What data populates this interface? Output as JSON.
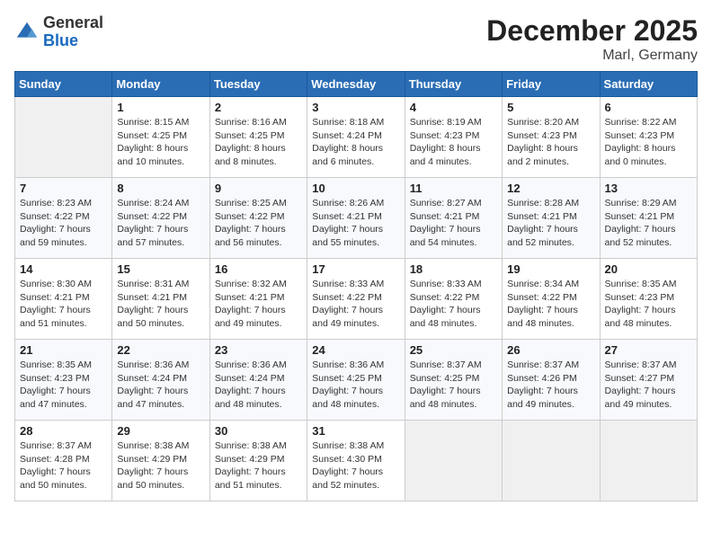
{
  "header": {
    "logo_general": "General",
    "logo_blue": "Blue",
    "title": "December 2025",
    "subtitle": "Marl, Germany"
  },
  "days_of_week": [
    "Sunday",
    "Monday",
    "Tuesday",
    "Wednesday",
    "Thursday",
    "Friday",
    "Saturday"
  ],
  "weeks": [
    [
      {
        "day": "",
        "info": ""
      },
      {
        "day": "1",
        "info": "Sunrise: 8:15 AM\nSunset: 4:25 PM\nDaylight: 8 hours\nand 10 minutes."
      },
      {
        "day": "2",
        "info": "Sunrise: 8:16 AM\nSunset: 4:25 PM\nDaylight: 8 hours\nand 8 minutes."
      },
      {
        "day": "3",
        "info": "Sunrise: 8:18 AM\nSunset: 4:24 PM\nDaylight: 8 hours\nand 6 minutes."
      },
      {
        "day": "4",
        "info": "Sunrise: 8:19 AM\nSunset: 4:23 PM\nDaylight: 8 hours\nand 4 minutes."
      },
      {
        "day": "5",
        "info": "Sunrise: 8:20 AM\nSunset: 4:23 PM\nDaylight: 8 hours\nand 2 minutes."
      },
      {
        "day": "6",
        "info": "Sunrise: 8:22 AM\nSunset: 4:23 PM\nDaylight: 8 hours\nand 0 minutes."
      }
    ],
    [
      {
        "day": "7",
        "info": "Sunrise: 8:23 AM\nSunset: 4:22 PM\nDaylight: 7 hours\nand 59 minutes."
      },
      {
        "day": "8",
        "info": "Sunrise: 8:24 AM\nSunset: 4:22 PM\nDaylight: 7 hours\nand 57 minutes."
      },
      {
        "day": "9",
        "info": "Sunrise: 8:25 AM\nSunset: 4:22 PM\nDaylight: 7 hours\nand 56 minutes."
      },
      {
        "day": "10",
        "info": "Sunrise: 8:26 AM\nSunset: 4:21 PM\nDaylight: 7 hours\nand 55 minutes."
      },
      {
        "day": "11",
        "info": "Sunrise: 8:27 AM\nSunset: 4:21 PM\nDaylight: 7 hours\nand 54 minutes."
      },
      {
        "day": "12",
        "info": "Sunrise: 8:28 AM\nSunset: 4:21 PM\nDaylight: 7 hours\nand 52 minutes."
      },
      {
        "day": "13",
        "info": "Sunrise: 8:29 AM\nSunset: 4:21 PM\nDaylight: 7 hours\nand 52 minutes."
      }
    ],
    [
      {
        "day": "14",
        "info": "Sunrise: 8:30 AM\nSunset: 4:21 PM\nDaylight: 7 hours\nand 51 minutes."
      },
      {
        "day": "15",
        "info": "Sunrise: 8:31 AM\nSunset: 4:21 PM\nDaylight: 7 hours\nand 50 minutes."
      },
      {
        "day": "16",
        "info": "Sunrise: 8:32 AM\nSunset: 4:21 PM\nDaylight: 7 hours\nand 49 minutes."
      },
      {
        "day": "17",
        "info": "Sunrise: 8:33 AM\nSunset: 4:22 PM\nDaylight: 7 hours\nand 49 minutes."
      },
      {
        "day": "18",
        "info": "Sunrise: 8:33 AM\nSunset: 4:22 PM\nDaylight: 7 hours\nand 48 minutes."
      },
      {
        "day": "19",
        "info": "Sunrise: 8:34 AM\nSunset: 4:22 PM\nDaylight: 7 hours\nand 48 minutes."
      },
      {
        "day": "20",
        "info": "Sunrise: 8:35 AM\nSunset: 4:23 PM\nDaylight: 7 hours\nand 48 minutes."
      }
    ],
    [
      {
        "day": "21",
        "info": "Sunrise: 8:35 AM\nSunset: 4:23 PM\nDaylight: 7 hours\nand 47 minutes."
      },
      {
        "day": "22",
        "info": "Sunrise: 8:36 AM\nSunset: 4:24 PM\nDaylight: 7 hours\nand 47 minutes."
      },
      {
        "day": "23",
        "info": "Sunrise: 8:36 AM\nSunset: 4:24 PM\nDaylight: 7 hours\nand 48 minutes."
      },
      {
        "day": "24",
        "info": "Sunrise: 8:36 AM\nSunset: 4:25 PM\nDaylight: 7 hours\nand 48 minutes."
      },
      {
        "day": "25",
        "info": "Sunrise: 8:37 AM\nSunset: 4:25 PM\nDaylight: 7 hours\nand 48 minutes."
      },
      {
        "day": "26",
        "info": "Sunrise: 8:37 AM\nSunset: 4:26 PM\nDaylight: 7 hours\nand 49 minutes."
      },
      {
        "day": "27",
        "info": "Sunrise: 8:37 AM\nSunset: 4:27 PM\nDaylight: 7 hours\nand 49 minutes."
      }
    ],
    [
      {
        "day": "28",
        "info": "Sunrise: 8:37 AM\nSunset: 4:28 PM\nDaylight: 7 hours\nand 50 minutes."
      },
      {
        "day": "29",
        "info": "Sunrise: 8:38 AM\nSunset: 4:29 PM\nDaylight: 7 hours\nand 50 minutes."
      },
      {
        "day": "30",
        "info": "Sunrise: 8:38 AM\nSunset: 4:29 PM\nDaylight: 7 hours\nand 51 minutes."
      },
      {
        "day": "31",
        "info": "Sunrise: 8:38 AM\nSunset: 4:30 PM\nDaylight: 7 hours\nand 52 minutes."
      },
      {
        "day": "",
        "info": ""
      },
      {
        "day": "",
        "info": ""
      },
      {
        "day": "",
        "info": ""
      }
    ]
  ]
}
